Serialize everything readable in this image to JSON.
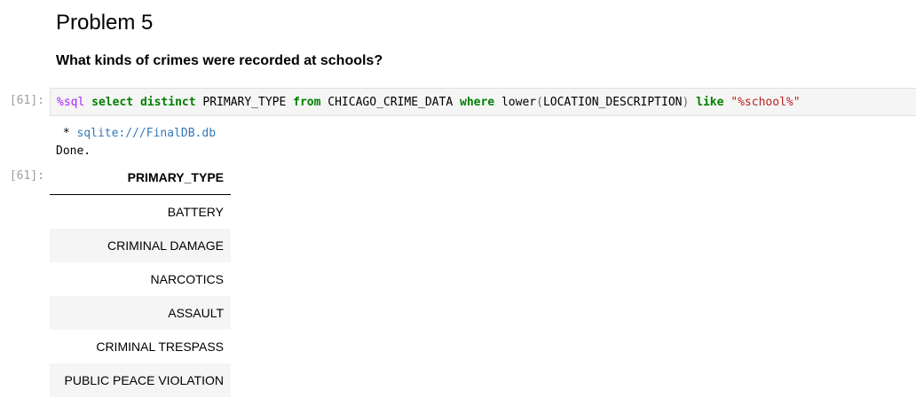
{
  "markdown": {
    "heading": "Problem 5",
    "question": "What kinds of crimes were recorded at schools?"
  },
  "input_cell": {
    "prompt": "[61]:",
    "code_tokens": {
      "magic": "%sql",
      "kw_select": "select",
      "kw_distinct": "distinct",
      "col_primary": "PRIMARY_TYPE",
      "kw_from": "from",
      "table": "CHICAGO_CRIME_DATA",
      "kw_where": "where",
      "func_lower": "lower",
      "paren_open": "(",
      "col_location": "LOCATION_DESCRIPTION",
      "paren_close": ")",
      "kw_like": "like",
      "pattern": "\"%school%\""
    }
  },
  "stream_output": {
    "connection_prefix": " * ",
    "connection": "sqlite:///FinalDB.db",
    "status": "Done."
  },
  "output_cell": {
    "prompt": "[61]:",
    "table": {
      "header": "PRIMARY_TYPE",
      "rows": [
        "BATTERY",
        "CRIMINAL DAMAGE",
        "NARCOTICS",
        "ASSAULT",
        "CRIMINAL TRESPASS",
        "PUBLIC PEACE VIOLATION"
      ]
    }
  },
  "colors": {
    "magic": "#aa22ff",
    "keyword": "#008000",
    "string": "#ba2121",
    "link": "#337ab7",
    "prompt": "#9e9e9e",
    "code_bg": "#f5f5f5"
  }
}
